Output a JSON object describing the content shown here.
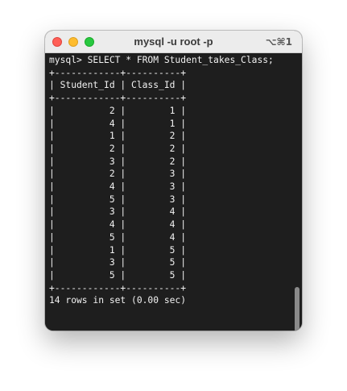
{
  "window": {
    "title": "mysql -u root -p",
    "shortcut": "⌥⌘1"
  },
  "terminal": {
    "lines": [
      "mysql> SELECT * FROM Student_takes_Class;",
      "+------------+----------+",
      "| Student_Id | Class_Id |",
      "+------------+----------+",
      "|          2 |        1 |",
      "|          4 |        1 |",
      "|          1 |        2 |",
      "|          2 |        2 |",
      "|          3 |        2 |",
      "|          2 |        3 |",
      "|          4 |        3 |",
      "|          5 |        3 |",
      "|          3 |        4 |",
      "|          4 |        4 |",
      "|          5 |        4 |",
      "|          1 |        5 |",
      "|          3 |        5 |",
      "|          5 |        5 |",
      "+------------+----------+",
      "14 rows in set (0.00 sec)"
    ]
  },
  "query_result": {
    "columns": [
      "Student_Id",
      "Class_Id"
    ],
    "rows": [
      [
        2,
        1
      ],
      [
        4,
        1
      ],
      [
        1,
        2
      ],
      [
        2,
        2
      ],
      [
        3,
        2
      ],
      [
        2,
        3
      ],
      [
        4,
        3
      ],
      [
        5,
        3
      ],
      [
        3,
        4
      ],
      [
        4,
        4
      ],
      [
        5,
        4
      ],
      [
        1,
        5
      ],
      [
        3,
        5
      ],
      [
        5,
        5
      ]
    ],
    "summary": "14 rows in set (0.00 sec)"
  }
}
